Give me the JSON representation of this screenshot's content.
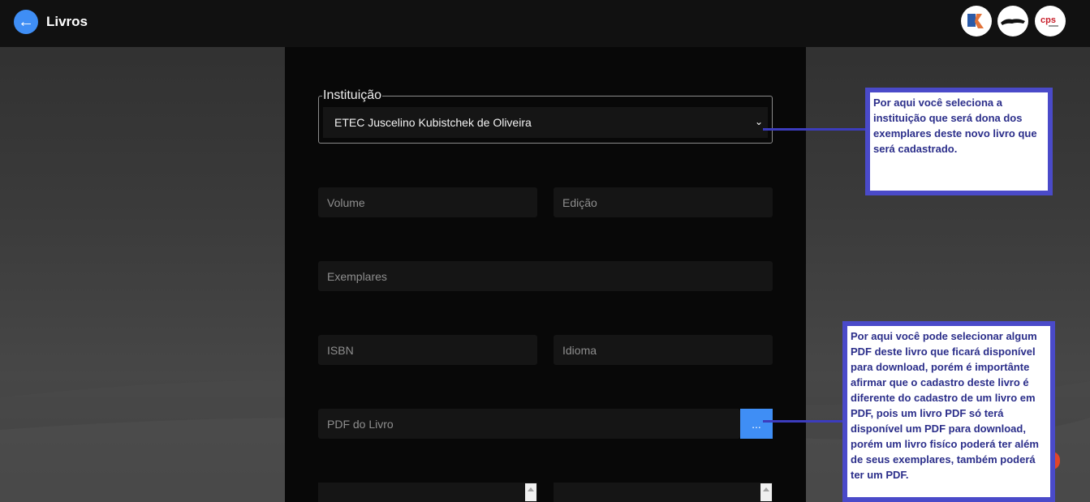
{
  "header": {
    "title": "Livros",
    "back_icon": "arrow-left-icon"
  },
  "logos": [
    "jk-logo",
    "jaguar-logo",
    "cps-logo"
  ],
  "form": {
    "institution_legend": "Instituição",
    "institution_value": "ETEC Juscelino Kubistchek de Oliveira",
    "volume_placeholder": "Volume",
    "edition_placeholder": "Edição",
    "copies_placeholder": "Exemplares",
    "isbn_placeholder": "ISBN",
    "language_placeholder": "Idioma",
    "pdf_placeholder": "PDF do Livro",
    "pdf_button_label": "..."
  },
  "callouts": {
    "institution": "Por aqui você seleciona a instituição que será dona dos exemplares deste novo livro que será cadastrado.",
    "pdf": "Por aqui você pode selecionar algum PDF deste livro que ficará disponível para download, porém é importânte afirmar que o cadastro deste livro é diferente do cadastro de um livro em PDF, pois um livro PDF só terá disponível um PDF para download, porém um livro fisíco poderá ter além de seus exemplares, também poderá ter um PDF."
  },
  "colors": {
    "accent": "#3f8ef5",
    "callout_border": "#4a4ac9",
    "callout_text": "#2b2e8a"
  }
}
